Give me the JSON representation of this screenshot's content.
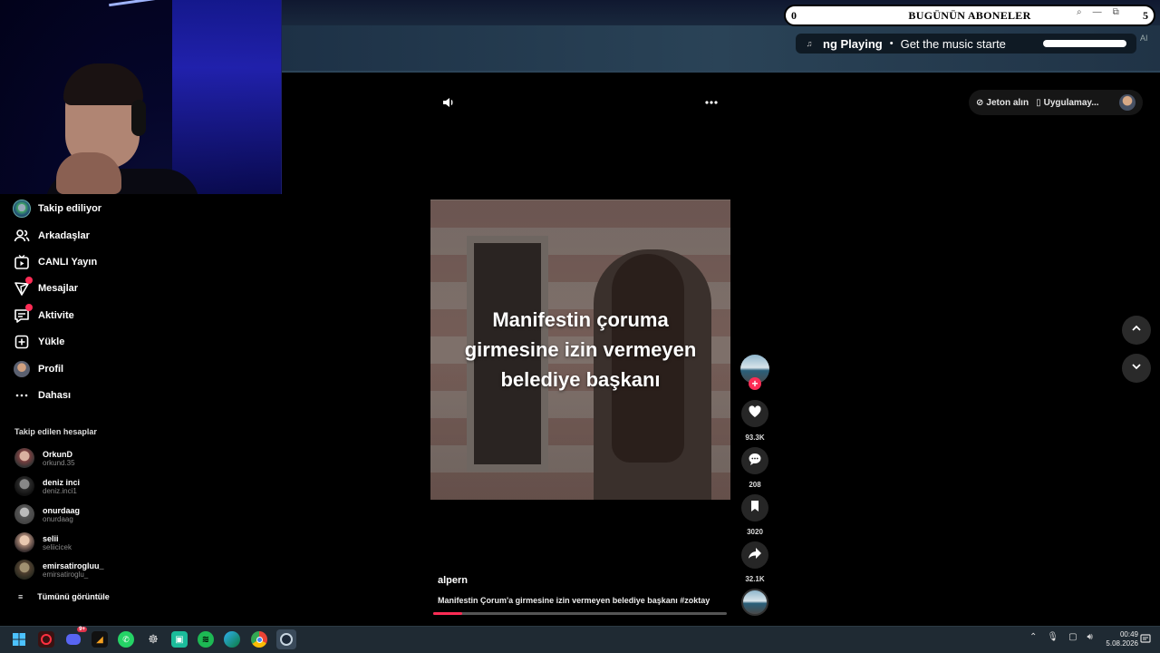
{
  "stream_overlay": {
    "subs_count": "0",
    "subs_label": "BUGÜNÜN ABONELER",
    "subs_goal": "5",
    "now_playing_title": "ng Playing",
    "now_playing_sep": "•",
    "now_playing_text": "Get the music starte",
    "ai_tag": "AI"
  },
  "header": {
    "coins_label": "Jeton alın",
    "app_label": "Uygulamay..."
  },
  "sidebar": {
    "items": [
      {
        "label": "Takip ediliyor",
        "icon": "following-avatar-icon"
      },
      {
        "label": "Arkadaşlar",
        "icon": "friends-icon"
      },
      {
        "label": "CANLI Yayın",
        "icon": "live-icon"
      },
      {
        "label": "Mesajlar",
        "icon": "inbox-icon"
      },
      {
        "label": "Aktivite",
        "icon": "activity-icon"
      },
      {
        "label": "Yükle",
        "icon": "upload-icon"
      },
      {
        "label": "Profil",
        "icon": "profile-icon"
      },
      {
        "label": "Dahası",
        "icon": "more-icon"
      }
    ],
    "following_title": "Takip edilen hesaplar",
    "accounts": [
      {
        "name": "OrkunD",
        "handle": "orkund.35"
      },
      {
        "name": "deniz inci",
        "handle": "deniz.inci1"
      },
      {
        "name": "onurdaag",
        "handle": "onurdaag"
      },
      {
        "name": "selii",
        "handle": "seliicicek"
      },
      {
        "name": "emirsatirogluu_",
        "handle": "emirsatiroglu_"
      }
    ],
    "see_all": "Tümünü görüntüle"
  },
  "video": {
    "caption_line1": "Manifestin çoruma",
    "caption_line2": "girmesine izin vermeyen",
    "caption_line3": "belediye başkanı",
    "author": "alpern",
    "description": "Manifestin Çorum'a girmesine izin vermeyen belediye başkanı #zoktay",
    "progress": 0.1
  },
  "actions": {
    "likes": "93.3K",
    "comments": "208",
    "saves": "3020",
    "shares": "32.1K"
  },
  "taskbar": {
    "discord_badge": "9+",
    "time": "00:49",
    "date": "5.08.2026"
  },
  "colors": {
    "accent": "#fe2c55",
    "background": "#000000",
    "taskbar": "#1f2a33"
  }
}
